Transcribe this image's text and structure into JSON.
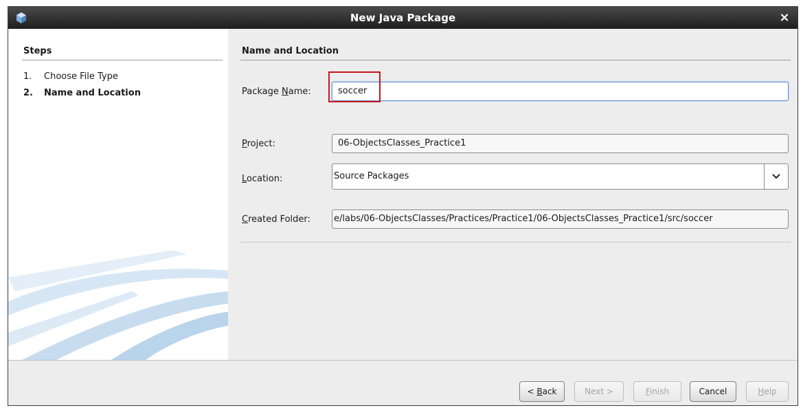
{
  "window": {
    "title": "New Java Package",
    "close_glyph": "×"
  },
  "steps": {
    "header": "Steps",
    "items": [
      {
        "num": "1.",
        "label": "Choose File Type"
      },
      {
        "num": "2.",
        "label": "Name and Location"
      }
    ]
  },
  "form": {
    "section_title": "Name and Location",
    "package_name": {
      "label_pre": "Package ",
      "label_mnemonic": "N",
      "label_post": "ame:",
      "value": "soccer"
    },
    "project": {
      "label_mnemonic": "P",
      "label_post": "roject:",
      "value": "06-ObjectsClasses_Practice1"
    },
    "location": {
      "label_mnemonic": "L",
      "label_post": "ocation:",
      "value": "Source Packages",
      "dropdown_icon": "chevron-down-icon"
    },
    "created_folder": {
      "label_mnemonic": "C",
      "label_post": "reated Folder:",
      "value": "e/labs/06-ObjectsClasses/Practices/Practice1/06-ObjectsClasses_Practice1/src/soccer"
    }
  },
  "buttons": {
    "back": {
      "pre": "< ",
      "mnemonic": "B",
      "post": "ack"
    },
    "next": {
      "label": "Next >"
    },
    "finish": {
      "mnemonic": "F",
      "post": "inish"
    },
    "cancel": {
      "label": "Cancel"
    },
    "help": {
      "mnemonic": "H",
      "post": "elp"
    }
  },
  "colors": {
    "highlight": "#c8151b",
    "titlebar": "#2a2a2a"
  }
}
